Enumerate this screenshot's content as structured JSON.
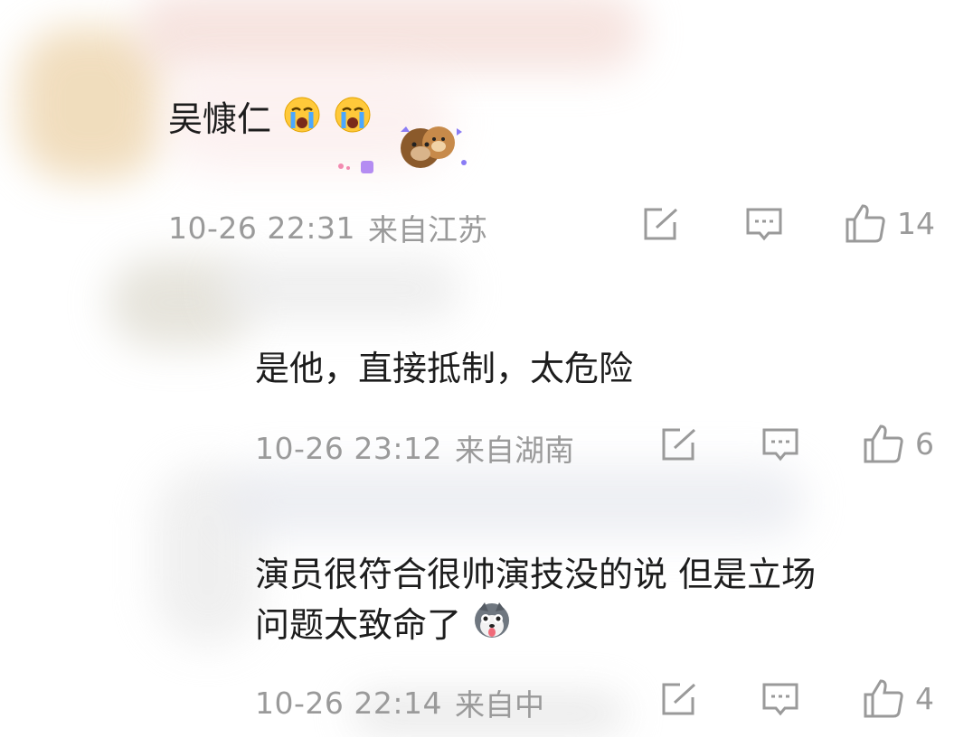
{
  "comments": [
    {
      "text": "吴慷仁",
      "emoji_names": [
        "loudly-crying-face-icon",
        "loudly-crying-face-icon"
      ],
      "sticker": "bear-sticker-icon",
      "time": "10-26 22:31",
      "location": "来自江苏",
      "likes": "14"
    },
    {
      "text": "是他，直接抵制，太危险",
      "time": "10-26 23:12",
      "location": "来自湖南",
      "likes": "6"
    },
    {
      "text_line1": "演员很符合很帅演技没的说 但是立场",
      "text_line2": "问题太致命了",
      "emoji_names": [
        "husky-dog-face-icon"
      ],
      "time": "10-26 22:14",
      "location": "来自中",
      "likes": "4"
    }
  ],
  "colors": {
    "meta": "#9a9a9a",
    "text": "#1d1d1d"
  }
}
